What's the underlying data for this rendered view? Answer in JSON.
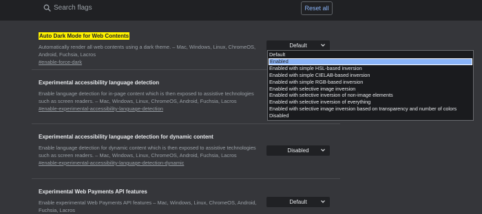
{
  "search": {
    "placeholder": "Search flags"
  },
  "toolbar": {
    "reset_label": "Reset all"
  },
  "flags": [
    {
      "title": "Auto Dark Mode for Web Contents",
      "description": "Automatically render all web contents using a dark theme. – Mac, Windows, Linux, ChromeOS, Android, Fuchsia, Lacros",
      "link": "#enable-force-dark",
      "value": "Default"
    },
    {
      "title": "Experimental accessibility language detection",
      "description": "Enable language detection for in-page content which is then exposed to assistive technologies such as screen readers. – Mac, Windows, Linux, ChromeOS, Android, Fuchsia, Lacros",
      "link": "#enable-experimental-accessibility-language-detection"
    },
    {
      "title": "Experimental accessibility language detection for dynamic content",
      "description": "Enable language detection for dynamic content which is then exposed to assistive technologies such as screen readers. – Mac, Windows, Linux, ChromeOS, Android, Fuchsia, Lacros",
      "link": "#enable-experimental-accessibility-language-detection-dynamic",
      "value": "Disabled"
    },
    {
      "title": "Experimental Web Payments API features",
      "description": "Enable experimental Web Payments API features – Mac, Windows, Linux, ChromeOS, Android, Fuchsia, Lacros",
      "value": "Default"
    }
  ],
  "dropdown_options": [
    "Default",
    "Enabled",
    "Enabled with simple HSL-based inversion",
    "Enabled with simple CIELAB-based inversion",
    "Enabled with simple RGB-based inversion",
    "Enabled with selective image inversion",
    "Enabled with selective inversion of non-image elements",
    "Enabled with selective inversion of everything",
    "Enabled with selective image inversion based on transparency and number of colors",
    "Disabled"
  ],
  "dropdown_selected": "Enabled",
  "colors": {
    "highlight": "#fff200",
    "accent": "#8ab4f8",
    "background": "#35363a"
  },
  "icons": {
    "search": "search-icon",
    "chevron": "chevron-down-icon"
  }
}
